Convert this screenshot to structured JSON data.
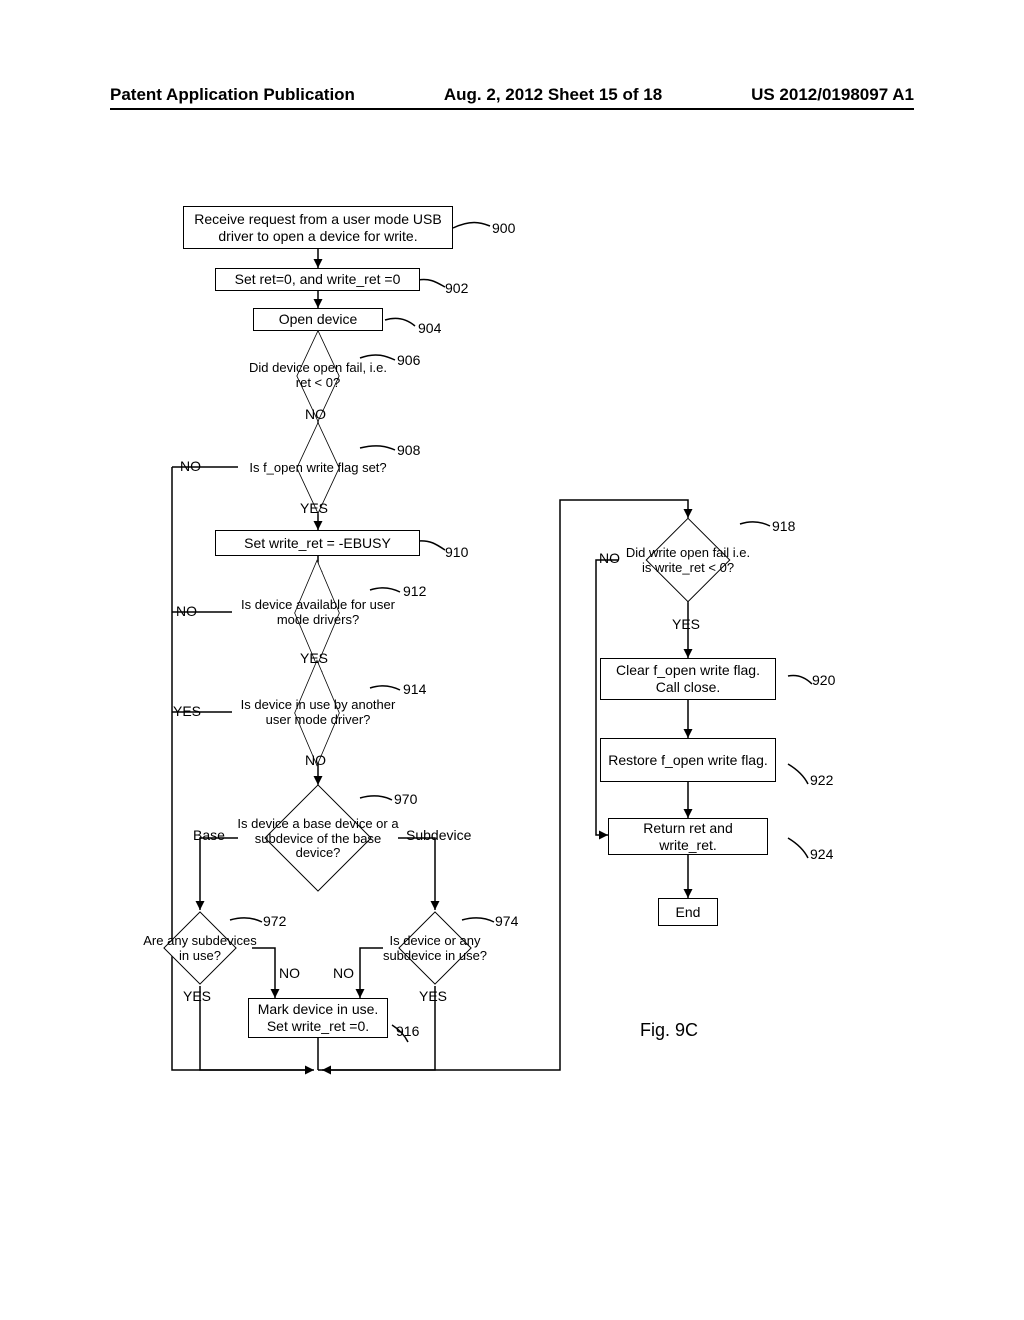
{
  "header": {
    "left": "Patent Application Publication",
    "center": "Aug. 2, 2012  Sheet 15 of 18",
    "right": "US 2012/0198097 A1"
  },
  "figure_label": "Fig. 9C",
  "nodes": {
    "n900": "Receive request from a user mode USB driver  to open a device for write.",
    "n902": "Set ret=0, and write_ret =0",
    "n904": "Open device",
    "n906": "Did device open fail, i.e. ret < 0?",
    "n908": "Is f_open write flag set?",
    "n910": "Set write_ret = -EBUSY",
    "n912": "Is device available for user mode drivers?",
    "n914": "Is device in use by another user mode driver?",
    "n970": "Is device a base device or a subdevice of the base device?",
    "n972": "Are any subdevices in use?",
    "n974": "Is device or any subdevice in use?",
    "n916": "Mark device in use. Set write_ret =0.",
    "n918": "Did write open fail i.e. is write_ret < 0?",
    "n920": "Clear f_open write flag. Call close.",
    "n922": "Restore f_open write flag.",
    "n924": "Return ret and write_ret.",
    "end": "End"
  },
  "refs": {
    "r900": "900",
    "r902": "902",
    "r904": "904",
    "r906": "906",
    "r908": "908",
    "r910": "910",
    "r912": "912",
    "r914": "914",
    "r970": "970",
    "r972": "972",
    "r974": "974",
    "r916": "916",
    "r918": "918",
    "r920": "920",
    "r922": "922",
    "r924": "924"
  },
  "edge_labels": {
    "yes": "YES",
    "no": "NO",
    "base": "Base",
    "subdevice": "Subdevice"
  }
}
